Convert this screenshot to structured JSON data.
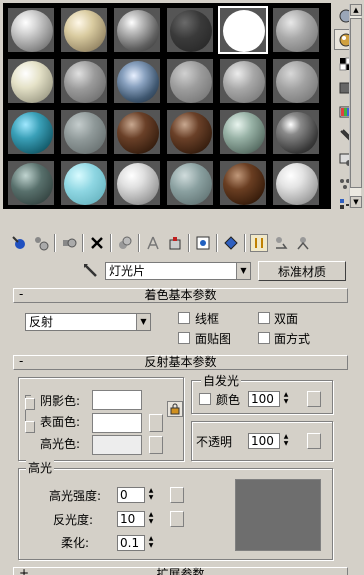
{
  "material_name": "灯光片",
  "material_type_button": "标准材质",
  "shader_rollout": {
    "title": "着色基本参数",
    "shader_value": "反射",
    "wire_label": "线框",
    "two_sided_label": "双面",
    "face_map_label": "面贴图",
    "faceted_label": "面方式"
  },
  "basic_rollout": {
    "title": "反射基本参数",
    "ambient_label": "阴影色:",
    "diffuse_label": "表面色:",
    "specular_label": "高光色:",
    "self_illum_title": "自发光",
    "color_label": "颜色",
    "self_illum_value": "100",
    "opacity_label": "不透明",
    "opacity_value": "100",
    "highlight_title": "高光",
    "spec_level_label": "高光强度:",
    "spec_level_value": "0",
    "glossiness_label": "反光度:",
    "glossiness_value": "10",
    "soften_label": "柔化:",
    "soften_value": "0.1"
  },
  "next_rollout_title": "扩展参数",
  "colors": {
    "ambient": "#ffffff",
    "diffuse": "#ffffff",
    "specular": "#ededed",
    "highlight_preview": "#6e6e6e"
  },
  "slots": [
    {
      "style": "radial-gradient(circle at 35% 30%, #ffffff 0%, #d8d8d8 25%, #8a8a8a 70%, #555 100%)"
    },
    {
      "style": "radial-gradient(circle at 35% 30%, #fff8e8 0%, #d9cba0 35%, #9b8c6a 75%, #5a5240 100%)"
    },
    {
      "style": "radial-gradient(circle at 35% 30%, #ffffff 0%, #c8c8c8 20%, #606060 65%, #2a2a2a 100%)"
    },
    {
      "style": "radial-gradient(circle at 35% 30%, #6a6a6a 0%, #3a3a3a 40%, #222 100%)"
    },
    {
      "style": "radial-gradient(circle at 35% 30%, #ffffff 0%, #ffffff 100%)"
    },
    {
      "style": "radial-gradient(circle at 35% 30%, #e8e8e8 0%, #a9a9a9 40%, #6d6d6d 100%)"
    },
    {
      "style": "radial-gradient(circle at 35% 30%, #ffffff 0%, #e5e2c8 35%, #a8a690 75%, #6b6a5a 100%)"
    },
    {
      "style": "radial-gradient(circle at 35% 30%, #e0e0e0 0%, #9a9a9a 40%, #5e5e5e 100%)"
    },
    {
      "style": "radial-gradient(circle at 40% 35%, #e8f0ff 0%, #8aa2c0 30%, #3f5770 65%, #1e2a36 100%)"
    },
    {
      "style": "radial-gradient(circle at 35% 30%, #d0d0d0 0%, #9c9c9c 40%, #6a6a6a 100%)"
    },
    {
      "style": "radial-gradient(circle at 35% 30%, #ececec 0%, #a7a7a7 40%, #6a6a6a 100%)"
    },
    {
      "style": "radial-gradient(circle at 35% 30%, #d8d8d8 0%, #a2a2a2 40%, #6b6b6b 100%)"
    },
    {
      "style": "radial-gradient(circle at 35% 30%, #a0e8ff 0%, #3aa0b8 35%, #166070 75%, #0a2e38 100%)"
    },
    {
      "style": "radial-gradient(circle at 35% 30%, #c4cccc 0%, #8e9898 40%, #5a6262 100%)"
    },
    {
      "style": "radial-gradient(circle at 35% 30%, #c8a890 0%, #6a4028 35%, #3a2010 75%, #1a0c04 100%)"
    },
    {
      "style": "radial-gradient(circle at 35% 30%, #c8a890 0%, #6a4028 35%, #3a2010 75%, #1a0c04 100%)"
    },
    {
      "style": "radial-gradient(circle at 35% 30%, #e8f4ee 0%, #98b2a6 35%, #5c7268 75%, #2e3a34 100%)"
    },
    {
      "style": "radial-gradient(circle at 35% 30%, #ffffff 0%, #8a8a8a 25%, #3a3a3a 70%, #1a1a1a 100%)"
    },
    {
      "style": "radial-gradient(circle at 35% 30%, #c0d4d0 0%, #58706c 40%, #24302e 100%)"
    },
    {
      "style": "radial-gradient(circle at 35% 30%, #d8fbff 0%, #8ed6e2 40%, #5aa8b4 100%)"
    },
    {
      "style": "radial-gradient(circle at 35% 30%, #ffffff 0%, #e0e0e0 30%, #9a9a9a 75%, #5a5a5a 100%)"
    },
    {
      "style": "radial-gradient(circle at 35% 30%, #d0dcdc 0%, #8aa0a0 40%, #536464 100%)"
    },
    {
      "style": "radial-gradient(circle at 35% 30%, #c0987a 0%, #6a3e22 35%, #3a1e0c 75%, #180a02 100%)"
    },
    {
      "style": "radial-gradient(circle at 35% 30%, #ffffff 0%, #e4e4e4 30%, #a0a0a0 75%, #606060 100%)"
    }
  ]
}
